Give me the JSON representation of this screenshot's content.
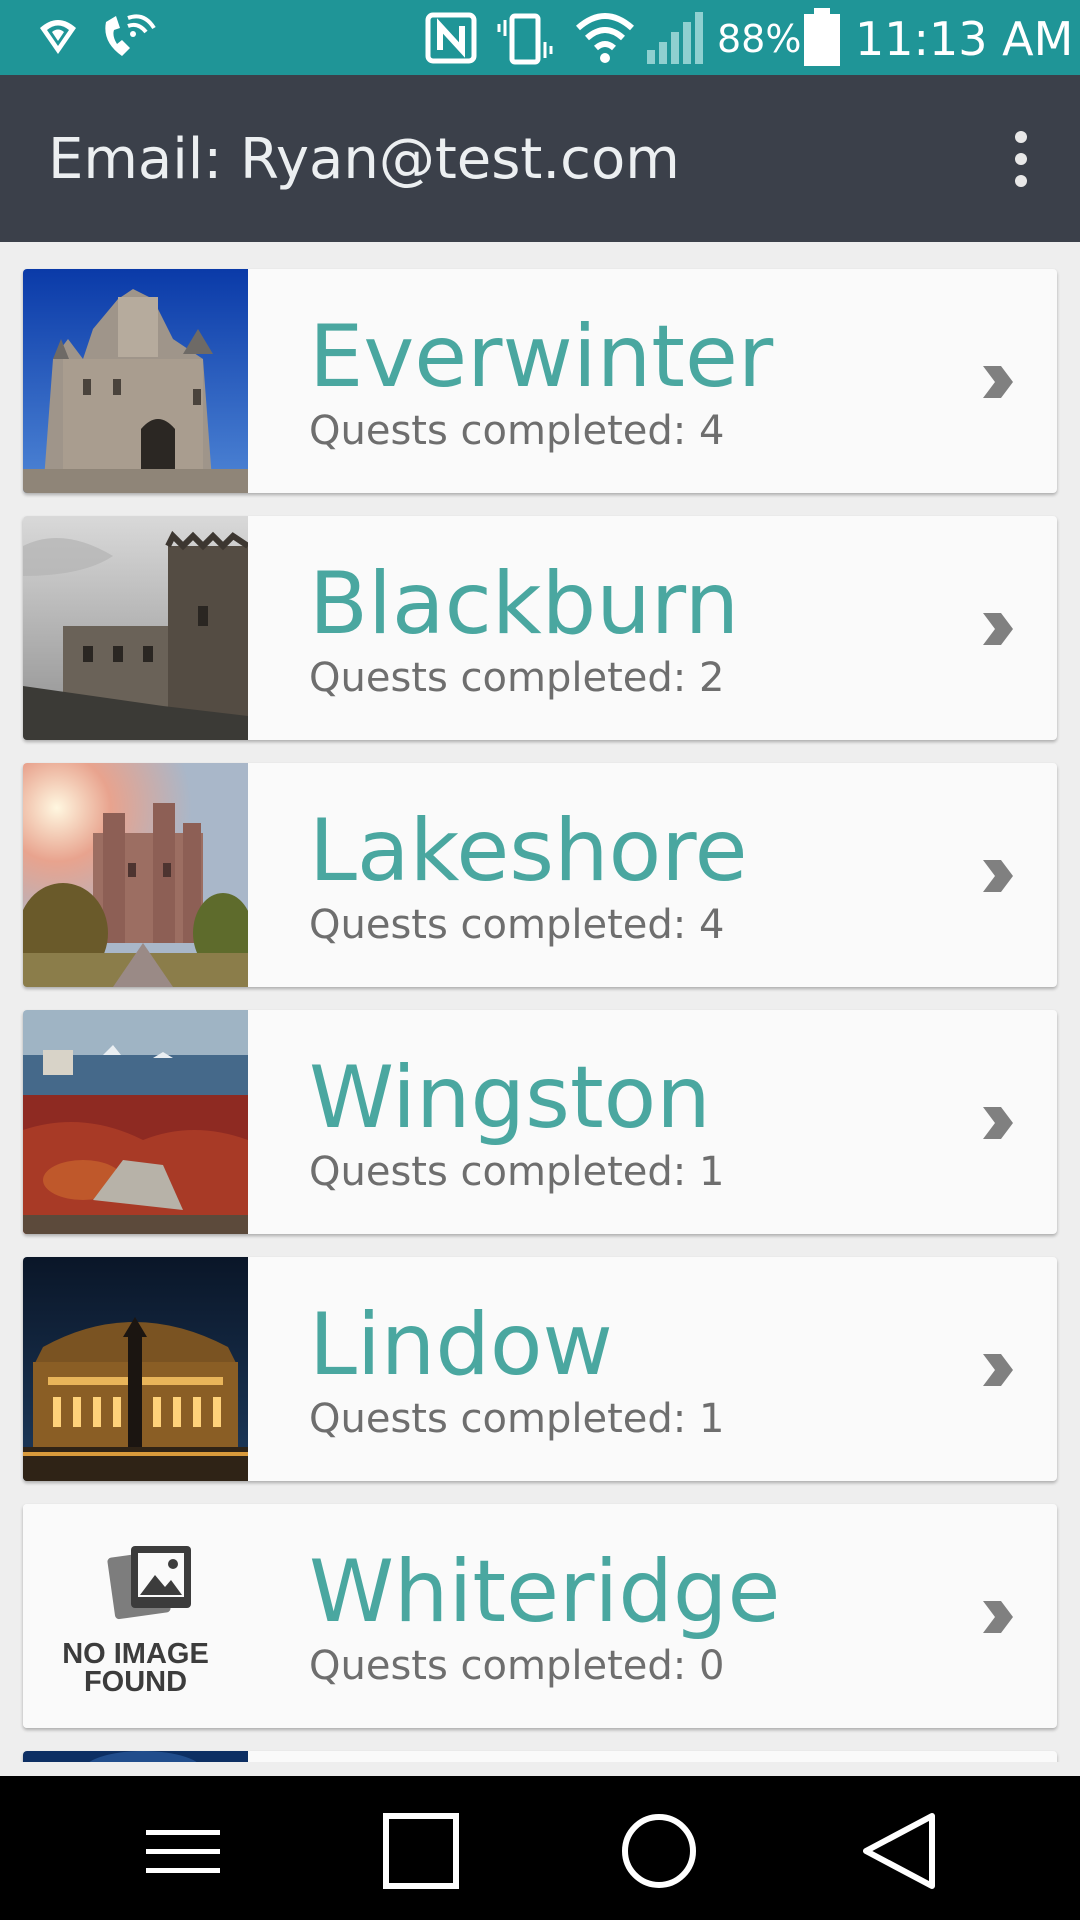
{
  "status_bar": {
    "battery": "88%",
    "time": "11:13 AM",
    "icons": [
      "wifi-hotspot-icon",
      "wifi-calling-icon",
      "nfc-icon",
      "vibrate-icon",
      "wifi-icon",
      "signal-icon",
      "battery-icon"
    ]
  },
  "app_bar": {
    "title": "Email: Ryan@test.com",
    "menu_icon": "more-vert-icon"
  },
  "towns": [
    {
      "name": "Everwinter",
      "quests": "Quests completed: 4"
    },
    {
      "name": "Blackburn",
      "quests": "Quests completed: 2"
    },
    {
      "name": "Lakeshore",
      "quests": "Quests completed: 4"
    },
    {
      "name": "Wingston",
      "quests": "Quests completed: 1"
    },
    {
      "name": "Lindow",
      "quests": "Quests completed: 1"
    },
    {
      "name": "Whiteridge",
      "quests": "Quests completed: 0",
      "no_image_line1": "NO IMAGE",
      "no_image_line2": "FOUND"
    }
  ],
  "nav_bar": {
    "buttons": [
      "menu-icon",
      "recents-icon",
      "home-icon",
      "back-icon"
    ]
  },
  "colors": {
    "status_bar": "#1f9597",
    "app_bar": "#3b404a",
    "accent_text": "#4aa7a0",
    "subtext": "#6e6e6e"
  }
}
